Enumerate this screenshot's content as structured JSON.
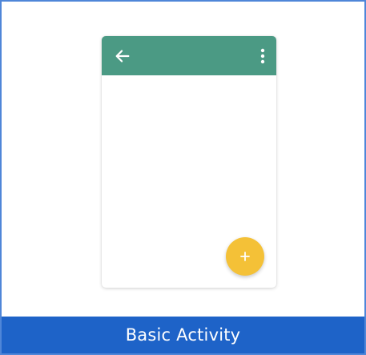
{
  "card": {
    "title": "Basic Activity",
    "border_color": "#4f86d8"
  },
  "phone_preview": {
    "appbar_color": "#4b9a84",
    "fab_color": "#f4c137",
    "icons": {
      "back": "arrow-left-icon",
      "overflow_menu": "more-vertical-icon",
      "fab": "plus-icon"
    }
  },
  "footer": {
    "background_color": "#1e63c8",
    "text_color": "#ffffff"
  }
}
